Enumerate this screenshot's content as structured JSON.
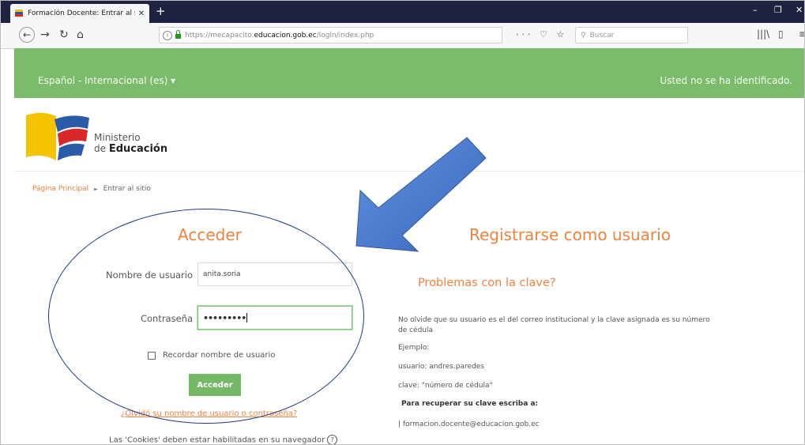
{
  "browser": {
    "tab_title": "Formación Docente: Entrar al s",
    "tab_close": "✕",
    "new_tab": "+",
    "url_prefix": "https://mecapacito.",
    "url_domain": "educacion.gob.ec",
    "url_path": "/login/index.php",
    "url_tools": "··· ♡ ☆",
    "search_placeholder": "Buscar",
    "window_minimize": "–",
    "window_restore": "❐",
    "window_close": "✕"
  },
  "header": {
    "language": "Español - Internacional (es) ▾",
    "login_status": "Usted no se ha identificado."
  },
  "logo": {
    "line1": "Ministerio",
    "line2_pre": "de ",
    "line2_bold": "Educación"
  },
  "breadcrumb": {
    "home": "Página Principal",
    "separator": "►",
    "current": "Entrar al sitio"
  },
  "login": {
    "title": "Acceder",
    "username_label": "Nombre de usuario",
    "username_value": "anita.soria",
    "password_label": "Contraseña",
    "password_value": "•••••••••",
    "remember_label": "Recordar nombre de usuario",
    "submit_label": "Acceder",
    "forgot_link": "¿Olvidó su nombre de usuario o contraseña?",
    "cookies_text": "Las 'Cookies' deben estar habilitadas en su navegador"
  },
  "register": {
    "title": "Registrarse como usuario",
    "problem_title": "Problemas con la clave?",
    "info_line1": "No olvide que su usuario es el del correo institucional y la clave asignada es su número",
    "info_line2": "de cédula",
    "example_label": "Ejemplo:",
    "example_user": "usuario: andres.paredes",
    "example_key": "clave: \"número de cédula\"",
    "recover_label": "Para recuperar su clave escriba a:",
    "recover_email": "| formacion.docente@educacion.gob.ec"
  },
  "colors": {
    "header_green": "#7cbb6c",
    "accent_orange": "#f0823c",
    "button_green": "#75b866",
    "annotation_blue": "#3a6bc6"
  }
}
